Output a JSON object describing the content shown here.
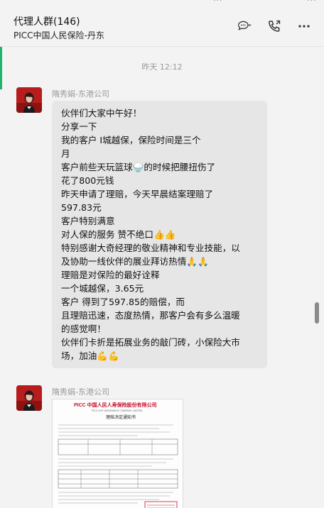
{
  "header": {
    "title": "代理人群(146)",
    "subtitle": "PICC中国人民保险-丹东"
  },
  "time_divider": "昨天 12:12",
  "messages": [
    {
      "sender": "隋秀娟-东港公司",
      "lines": [
        "伙伴们大家中午好！",
        "分享一下",
        "我的客户                   I城越保，保险时间是三个",
        "月",
        "客户前些天玩篮球🍚的时候把腰扭伤了",
        "花了800元钱",
        "昨天申请了理赔，今天早晨结案理赔了",
        "597.83元",
        "客户特别满意",
        "对人保的服务 赞不绝口👍👍",
        "特别感谢大奇经理的敬业精神和专业技能，以",
        "及协助一线伙伴的展业拜访热情🙏🙏",
        "理赔是对保险的最好诠释",
        "一个城越保，3.65元",
        "客户                  得到了597.85的赔偿，而",
        "且理赔迅速，态度热情，那客户会有多么温暖",
        "的感觉啊！",
        "伙伴们卡折是拓展业务的敲门砖，小保险大市",
        "场，加油💪💪"
      ]
    },
    {
      "sender": "隋秀娟-东港公司",
      "document": {
        "header_line": "PICC 中国人民人寿保险股份有限公司",
        "subheader": "PICC LIFE INSURANCE COMPANY LIMITED",
        "doc_title": "理赔决定通知书"
      }
    }
  ],
  "colors": {
    "accent_green": "#20b36b",
    "bubble_bg": "#e6e6e6",
    "picc_red": "#c8102e"
  }
}
